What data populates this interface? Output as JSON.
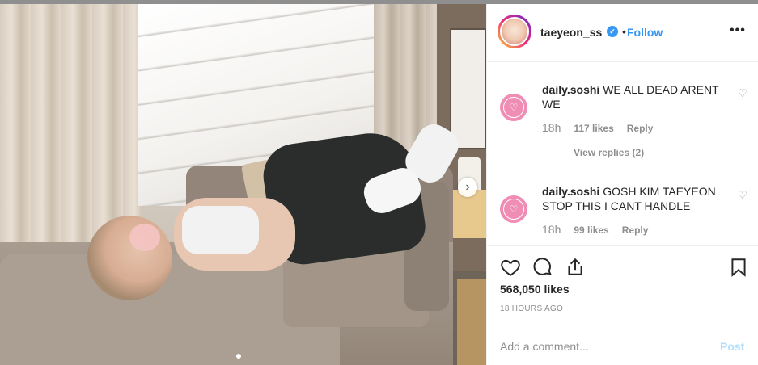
{
  "post": {
    "username": "taeyeon_ss",
    "verified": true,
    "separator": "•",
    "follow_label": "Follow",
    "more_label": "•••",
    "likes_text": "568,050 likes",
    "time_ago": "18 HOURS AGO",
    "carousel": {
      "next_label": "›",
      "total_slides": 2,
      "active_slide": 1
    }
  },
  "comments": [
    {
      "username": "daily.soshi",
      "text": "WE ALL DEAD ARENT WE",
      "time": "18h",
      "likes": "117 likes",
      "reply_label": "Reply",
      "view_replies": "View replies (2)"
    },
    {
      "username": "daily.soshi",
      "text": "GOSH KIM TAEYEON STOP THIS I CANT HANDLE",
      "time": "18h",
      "likes": "99 likes",
      "reply_label": "Reply"
    }
  ],
  "actions": {
    "like_icon": "heart-outline-icon",
    "comment_icon": "comment-bubble-icon",
    "share_icon": "share-upload-icon",
    "save_icon": "bookmark-icon"
  },
  "add_comment": {
    "placeholder": "Add a comment...",
    "post_label": "Post"
  },
  "colors": {
    "accent_blue": "#3897f0",
    "post_button_disabled": "#b2dffc",
    "muted_text": "#8e8e8e",
    "comment_avatar_pink": "#ef8db5"
  }
}
